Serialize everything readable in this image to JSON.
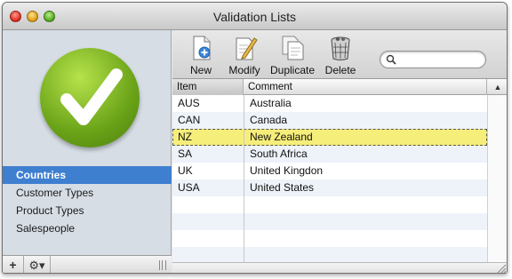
{
  "window": {
    "title": "Validation Lists"
  },
  "colors": {
    "accent": "#3f7fd0",
    "highlight": "#f6ee7a",
    "badge": "#6aa318"
  },
  "sidebar": {
    "badge_icon": "checkmark-icon",
    "items": [
      {
        "label": "Countries",
        "selected": true
      },
      {
        "label": "Customer Types",
        "selected": false
      },
      {
        "label": "Product Types",
        "selected": false
      },
      {
        "label": "Salespeople",
        "selected": false
      }
    ],
    "footer": {
      "add_label": "+",
      "gear_label": "⚙▾"
    }
  },
  "toolbar": {
    "new_label": "New",
    "modify_label": "Modify",
    "duplicate_label": "Duplicate",
    "delete_label": "Delete",
    "search_placeholder": ""
  },
  "table": {
    "columns": [
      "Item",
      "Comment"
    ],
    "rows": [
      {
        "item": "AUS",
        "comment": "Australia"
      },
      {
        "item": "CAN",
        "comment": "Canada"
      },
      {
        "item": "NZ",
        "comment": "New Zealand",
        "highlighted": true
      },
      {
        "item": "SA",
        "comment": "South Africa"
      },
      {
        "item": "UK",
        "comment": "United Kingdon"
      },
      {
        "item": "USA",
        "comment": "United States"
      }
    ]
  }
}
